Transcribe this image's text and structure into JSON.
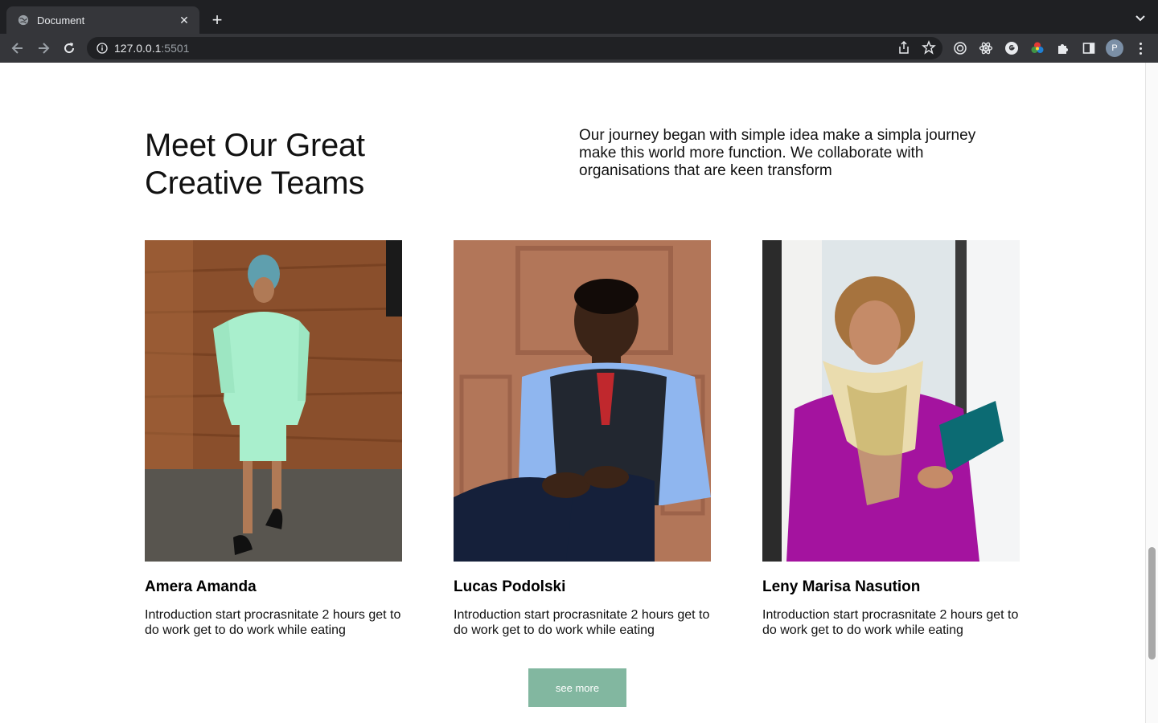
{
  "browser": {
    "tab_title": "Document",
    "tab_close": "✕",
    "new_tab": "+",
    "url_host": "127.0.0.1",
    "url_port": ":5501",
    "profile_initial": "P"
  },
  "section": {
    "title_line1": "Meet Our Great",
    "title_line2": "Creative Teams",
    "intro": "Our journey began with simple idea make a simpla journey make this world more function. We collaborate with organisations that are keen transform"
  },
  "team": [
    {
      "name": "Amera Amanda",
      "description": "Introduction start procrasnitate 2 hours get to do work get to do work while eating"
    },
    {
      "name": "Lucas Podolski",
      "description": "Introduction start procrasnitate 2 hours get to do work get to do work while eating"
    },
    {
      "name": "Leny Marisa Nasution",
      "description": "Introduction start procrasnitate 2 hours get to do work get to do work while eating"
    }
  ],
  "cta": {
    "label": "see more"
  },
  "colors": {
    "accent_button": "#82b7a0",
    "chrome_dark": "#1f2023",
    "chrome_toolbar": "#35363a"
  }
}
